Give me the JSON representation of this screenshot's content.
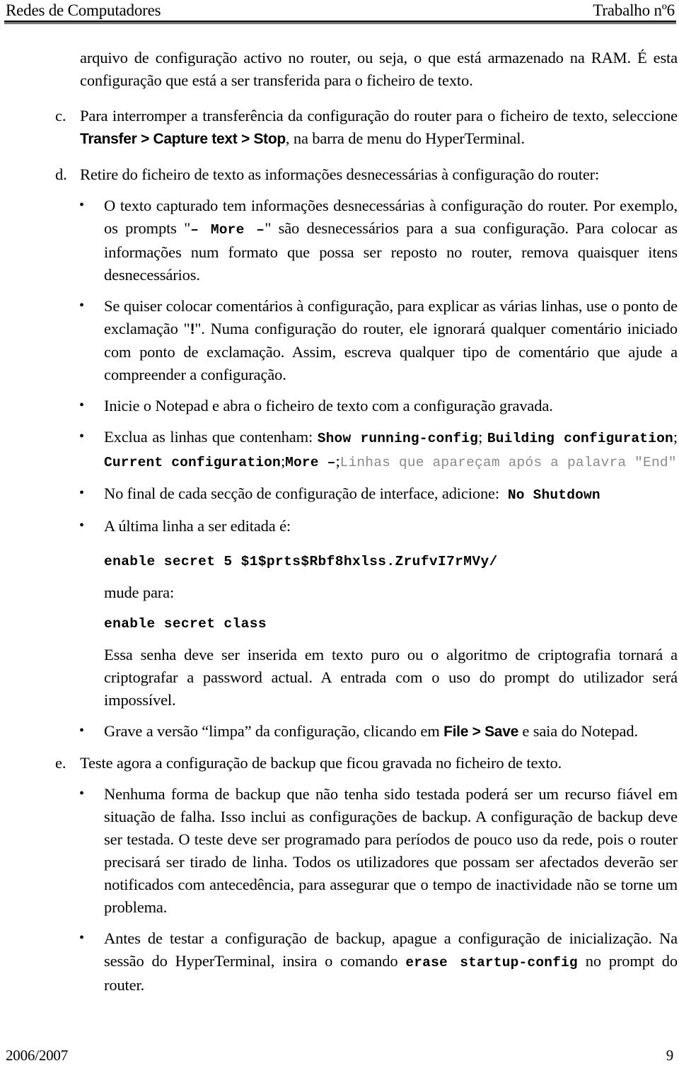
{
  "header": {
    "left": "Redes de Computadores",
    "right": "Trabalho nº6"
  },
  "footer": {
    "left": "2006/2007",
    "page_number": "9"
  },
  "body": {
    "continuation_paragraph": "arquivo de configuração activo no router, ou seja, o que está armazenado na RAM. É esta configuração que está a ser transferida para o ficheiro de texto.",
    "item_c": {
      "marker": "c.",
      "text_before": "Para interromper a transferência da configuração do router para o ficheiro de texto, seleccione ",
      "menu_path": "Transfer > Capture text > Stop",
      "text_after": ", na barra de menu do HyperTerminal."
    },
    "item_d": {
      "marker": "d.",
      "text": "Retire do ficheiro de texto as informações desnecessárias à configuração do router:"
    },
    "bullet_1": {
      "part1": "O texto capturado tem informações desnecessárias à configuração do router. Por exemplo, os prompts \"",
      "code": "– More –",
      "part2": "\" são desnecessários para a sua configuração. Para colocar as informações num formato que possa ser reposto no router, remova quaisquer itens desnecessários."
    },
    "bullet_2": {
      "part1": "Se quiser colocar comentários à configuração, para explicar as várias linhas, use o ponto de exclamação \"",
      "code": "!",
      "part2": "\". Numa configuração do router, ele ignorará qualquer comentário iniciado com ponto de exclamação. Assim, escreva qualquer tipo de comentário que ajude a compreender a configuração."
    },
    "bullet_3": {
      "text": "Inicie o Notepad e abra o ficheiro de texto com a configuração gravada."
    },
    "bullet_4": {
      "lead": "Exclua as linhas que contenham: ",
      "code_1": "Show  running-config",
      "sep_1": "; ",
      "code_2": "Building configuration",
      "sep_2": "; ",
      "code_3": "Current configuration",
      "sep_3": ";",
      "code_4": "More –",
      "sep_4": ";",
      "code_gray": "Linhas que apareçam após a palavra \"End\""
    },
    "bullet_5": {
      "lead": "No final de cada secção de configuração de interface, adicione:",
      "code": " No Shutdown"
    },
    "bullet_6": {
      "lead": "A última linha a ser editada é:",
      "code_before": "enable secret 5 $1$prts$Rbf8hxlss.ZrufvI7rMVy/",
      "change_label": "mude para:",
      "code_after": "enable secret class",
      "closing": "Essa senha deve ser inserida em texto puro ou o algoritmo de criptografia tornará a criptografar a password actual. A entrada com o uso do prompt do utilizador será impossível."
    },
    "bullet_7": {
      "part1": "Grave a versão “limpa” da configuração, clicando em ",
      "menu_path": "File > Save",
      "part2": " e saia do Notepad."
    },
    "item_e": {
      "marker": "e.",
      "text": "Teste agora a configuração de backup que ficou gravada no ficheiro de texto."
    },
    "bullet_8": {
      "text": "Nenhuma forma de backup que não tenha sido testada poderá ser um recurso fiável em situação de falha. Isso inclui as configurações de backup. A configuração de backup deve ser testada. O teste deve ser programado para períodos de pouco uso da rede, pois o router precisará ser tirado de linha. Todos os utilizadores que possam ser afectados deverão ser notificados com antecedência, para assegurar que o tempo de inactividade não se torne um problema."
    },
    "bullet_9": {
      "part1": "Antes de testar a configuração de backup, apague a configuração de inicialização. Na sessão do HyperTerminal, insira o comando ",
      "code": "erase startup-config",
      "part2": " no prompt do router."
    },
    "bullet_glyph": "•"
  }
}
